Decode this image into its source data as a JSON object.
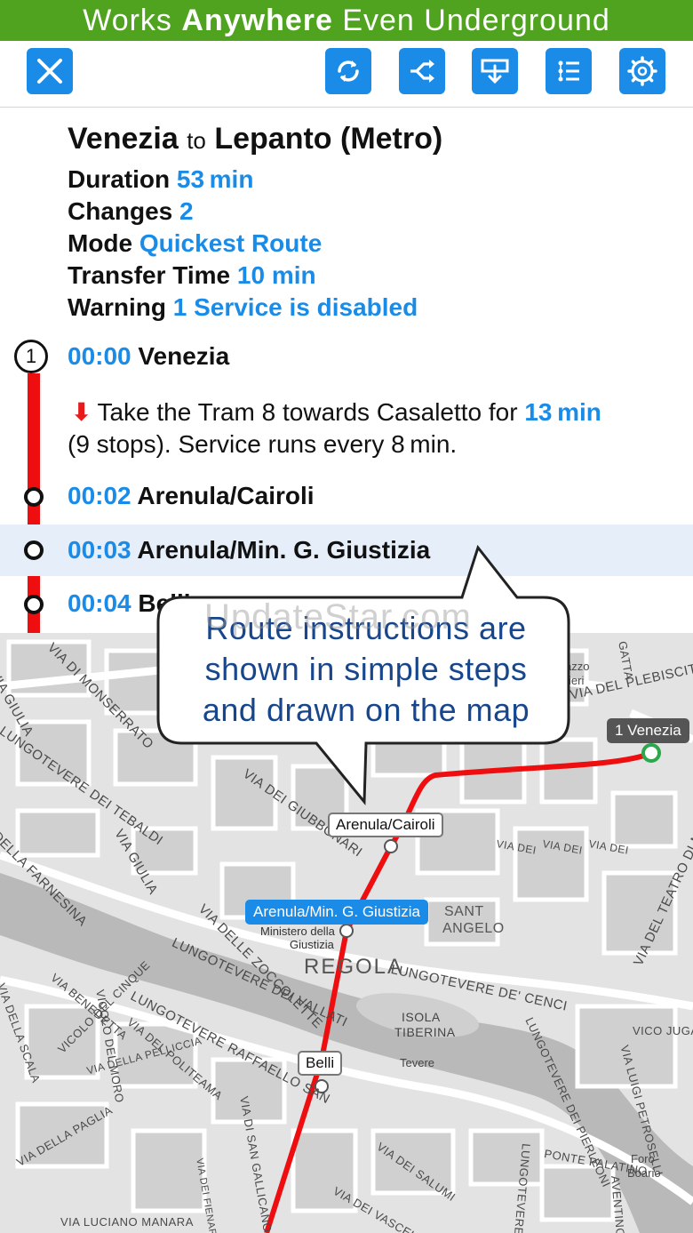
{
  "banner": {
    "prefix": "Works",
    "bold": "Anywhere",
    "suffix": "Even Underground"
  },
  "toolbar": {
    "icons": [
      "close-icon",
      "refresh-icon",
      "shuffle-icon",
      "download-icon",
      "list-icon",
      "settings-gear-icon"
    ]
  },
  "route": {
    "from": "Venezia",
    "to_word": "to",
    "to": "Lepanto (Metro)",
    "duration_label": "Duration",
    "duration_value": "53 min",
    "changes_label": "Changes",
    "changes_value": "2",
    "mode_label": "Mode",
    "mode_value": "Quickest Route",
    "transfer_label": "Transfer Time",
    "transfer_value": "10 min",
    "warning_label": "Warning",
    "warning_value": "1 Service is disabled"
  },
  "steps": [
    {
      "badge": "1",
      "time": "00:00",
      "name": "Venezia"
    },
    {
      "time": "00:02",
      "name": "Arenula/Cairoli"
    },
    {
      "time": "00:03",
      "name": "Arenula/Min. G. Giustizia"
    },
    {
      "time": "00:04",
      "name": "Belli"
    }
  ],
  "instruction": {
    "text_before": "Take the Tram 8 towards Casaletto for",
    "duration": "13 min",
    "text_after": "(9 stops). Service runs every 8 min."
  },
  "callout": {
    "line1": "Route instructions are",
    "line2": "shown in simple steps",
    "line3": "and drawn on the map"
  },
  "watermark": "UpdateStar.com",
  "map": {
    "stops": {
      "venezia": "1  Venezia",
      "cairoli": "Arenula/Cairoli",
      "giustizia": "Arenula/Min. G. Giustizia",
      "belli": "Belli"
    },
    "labels": {
      "via_giulia_top": "VIA GIULIA",
      "monserrato": "VIA DI MONSERRATO",
      "lung_tebaldi": "LUNGOTEVERE DEI TEBALDI",
      "via_giulia_mid": "VIA GIULIA",
      "farnesina": "DELLA FARNESINA",
      "giubbonari": "VIA DEI GIUBBONARI",
      "zoccolette": "VIA DELLE ZOCCOLETTE",
      "lung_vallati": "LUNGOTEVERE DEI VALLATI",
      "ministero": "Ministero della",
      "giustizia": "Giustizia",
      "regola": "REGOLA",
      "sant": "SANT",
      "angelo": "ANGELO",
      "lung_cenci": "LUNGOTEVERE DE' CENCI",
      "plebiscito": "VIA DEL PLEBISCITO",
      "palazzo": "azzo",
      "ieri": "ieri",
      "gatta": "GATTA",
      "teatro": "VIA DEL TEATRO DI MARCELLO",
      "isola": "ISOLA",
      "tiberina": "TIBERINA",
      "tevere": "Tevere",
      "vico_jugario": "VICO JUGARIO",
      "luigi_petroselli": "VIA LUIGI PETROSELLI",
      "pierleoni": "LUNGOTEVERE DEI PIERLEONI",
      "benedetta": "VIA BENEDETTA",
      "cinque": "VICOLO DEL CINQUE",
      "politeama": "VIA DEL POLITEAMA",
      "lung_raffaello": "LUNGOTEVERE RAFFAELLO SAN",
      "della_scala": "VIA DELLA SCALA",
      "moro": "VICOLO DEL MORO",
      "pelliccia": "VIA DELLA PELLICCIA",
      "della_paglia": "VIA DELLA PAGLIA",
      "san_gallicano": "VIA DI SAN GALLICANO",
      "fienaroli": "VIA DEI FIENAROLI",
      "salumi": "VIA DEI SALUMI",
      "vascellari": "VIA DEI VASCELLARI",
      "luciano_manara": "VIA LUCIANO MANARA",
      "ponte_palatino": "PONTE PALATINO",
      "foro": "Foro",
      "boario": "Boario",
      "lungotevere_r": "LUNGOTEVERE",
      "aventino": "AVENTINO",
      "via_dei": "VIA DEI"
    }
  },
  "colors": {
    "accent": "#1a8ce8",
    "banner": "#4fa31e",
    "route": "#ee0e10",
    "highlight": "#e6eff9",
    "callout_text": "#17468c"
  }
}
